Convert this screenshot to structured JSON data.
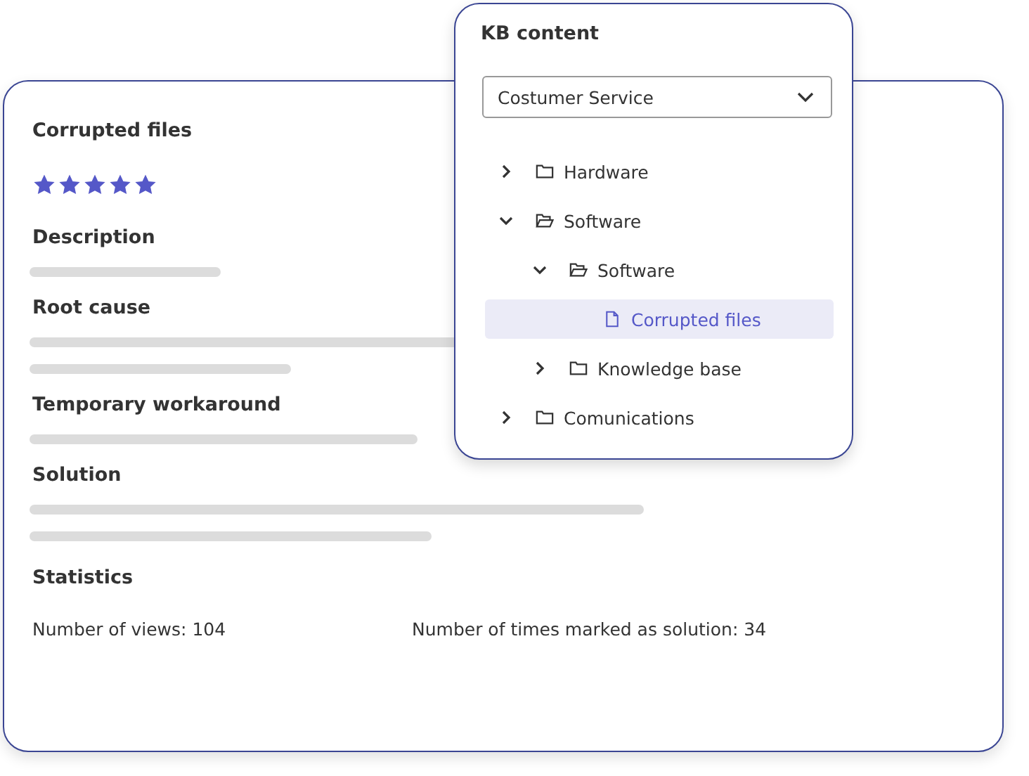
{
  "article": {
    "title": "Corrupted files",
    "stars": 5,
    "sections": [
      {
        "title": "Description"
      },
      {
        "title": "Root cause"
      },
      {
        "title": "Temporary workaround"
      },
      {
        "title": "Solution"
      }
    ],
    "statistics": {
      "title": "Statistics",
      "items": [
        "Number of views: 104",
        "Number of times marked as solution: 34"
      ]
    }
  },
  "kb_panel": {
    "title": "KB content",
    "dropdown": {
      "value": "Costumer Service"
    },
    "tree": [
      {
        "label": "Hardware",
        "kind": "folder",
        "expanded": false,
        "selected": false
      },
      {
        "label": "Software",
        "kind": "folder",
        "expanded": true,
        "selected": false,
        "children": [
          {
            "label": "Software",
            "kind": "folder",
            "expanded": true,
            "selected": false,
            "children": [
              {
                "label": "Corrupted files",
                "kind": "file",
                "selected": true
              }
            ]
          },
          {
            "label": "Knowledge base",
            "kind": "folder",
            "expanded": false,
            "selected": false
          }
        ]
      },
      {
        "label": "Comunications",
        "kind": "folder",
        "expanded": false,
        "selected": false
      }
    ]
  }
}
